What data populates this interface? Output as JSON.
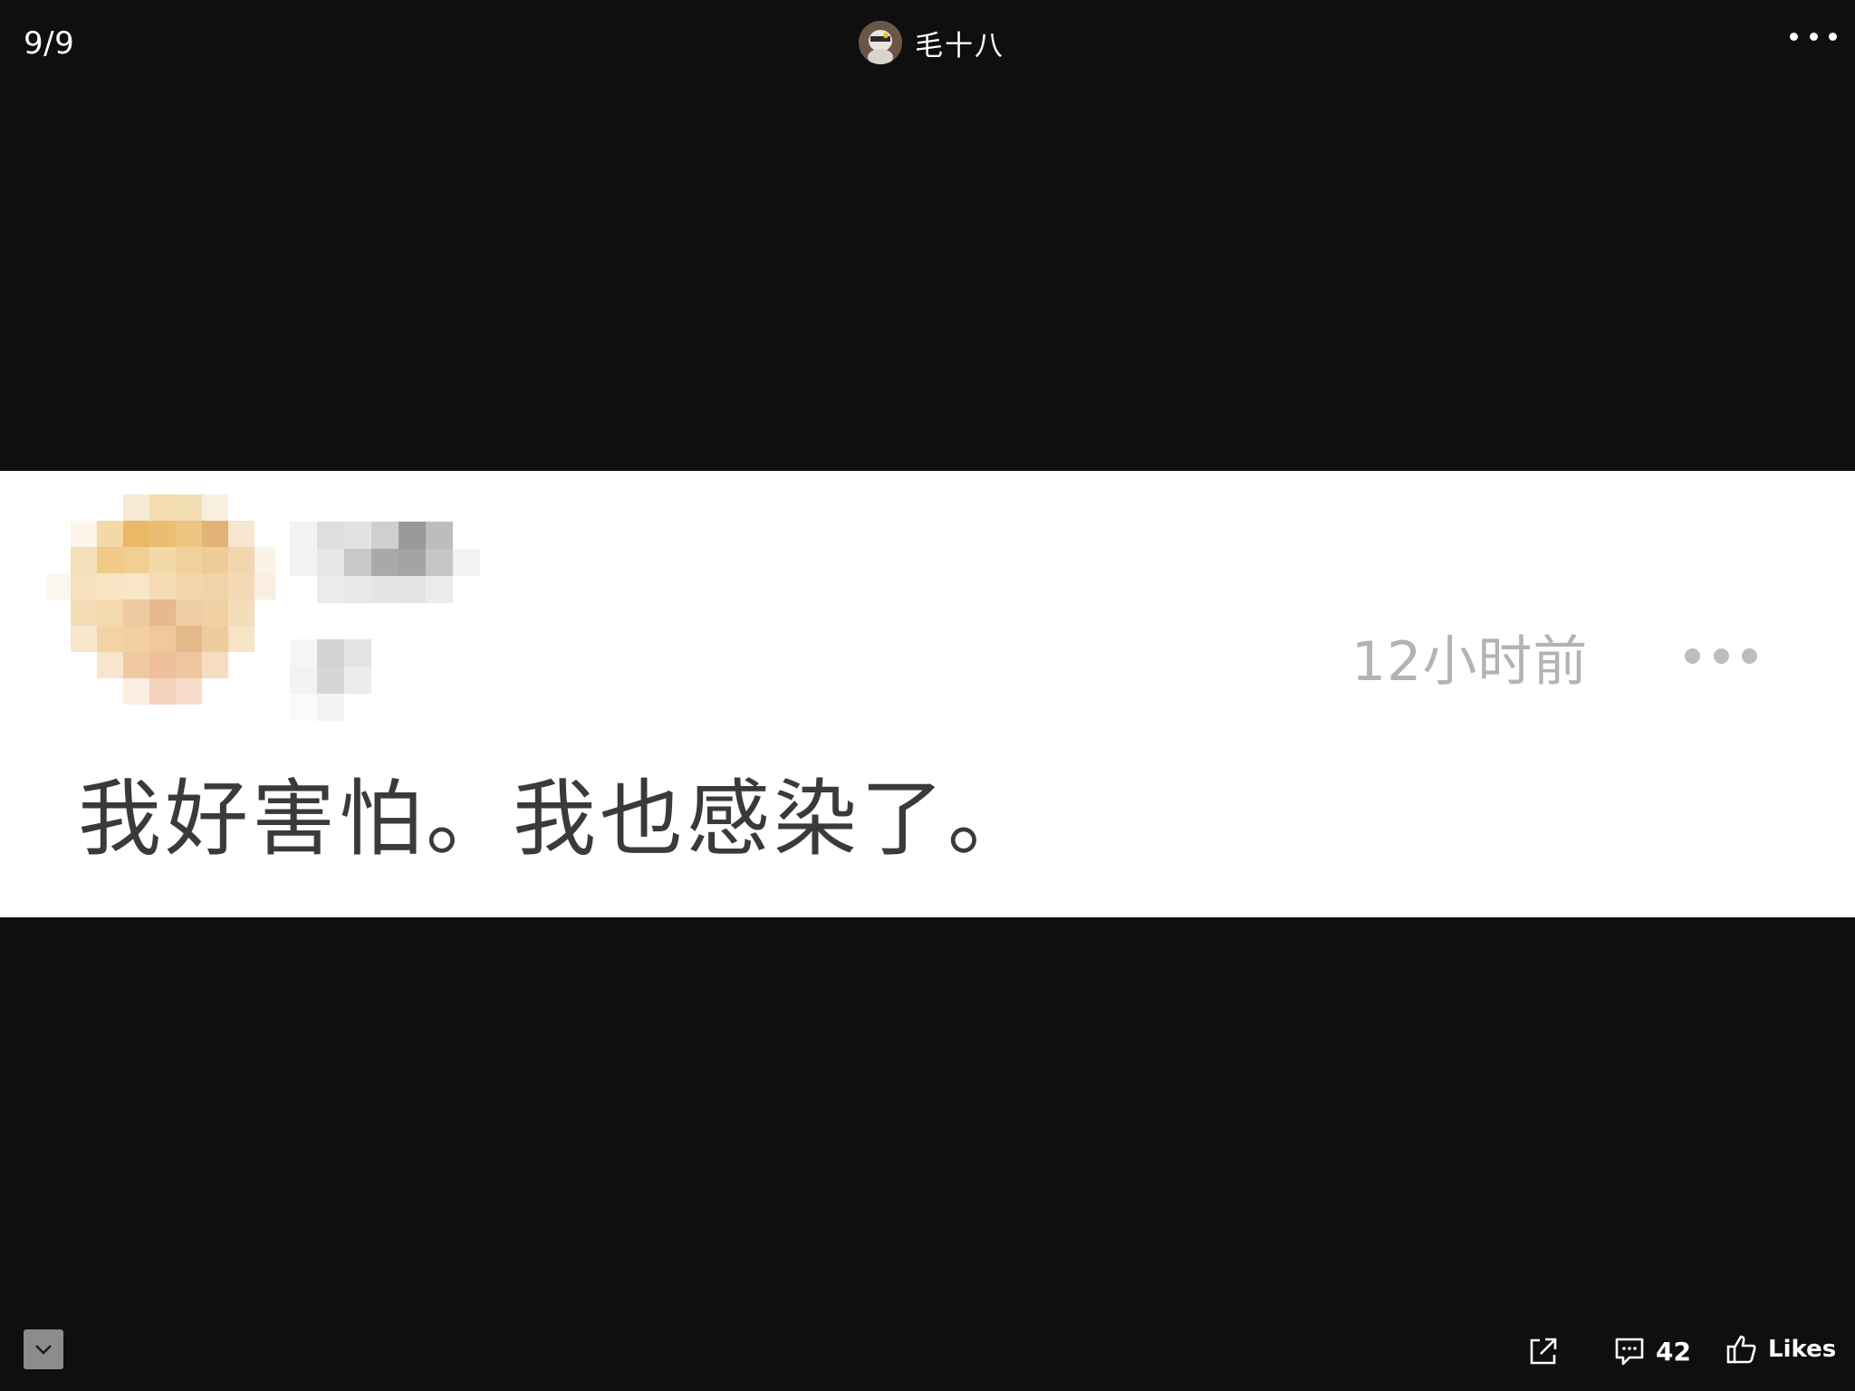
{
  "top_bar": {
    "page_counter": "9/9",
    "author_name": "毛十八",
    "more_icon": "more-horizontal-icon"
  },
  "photo": {
    "comment": {
      "time": "12小时前",
      "text": "我好害怕。我也感染了。",
      "more_icon": "more-horizontal-icon"
    }
  },
  "bottom_bar": {
    "collapse_icon": "chevron-down-icon",
    "share_icon": "share-external-icon",
    "comment_icon": "comment-icon",
    "comment_count": "42",
    "like_icon": "thumbs-up-icon",
    "likes_label": "Likes"
  },
  "colors": {
    "background": "#0f0f0f",
    "photo_background": "#ffffff",
    "comment_text": "#3a3a3a",
    "timestamp_text": "#b3b3b3"
  }
}
